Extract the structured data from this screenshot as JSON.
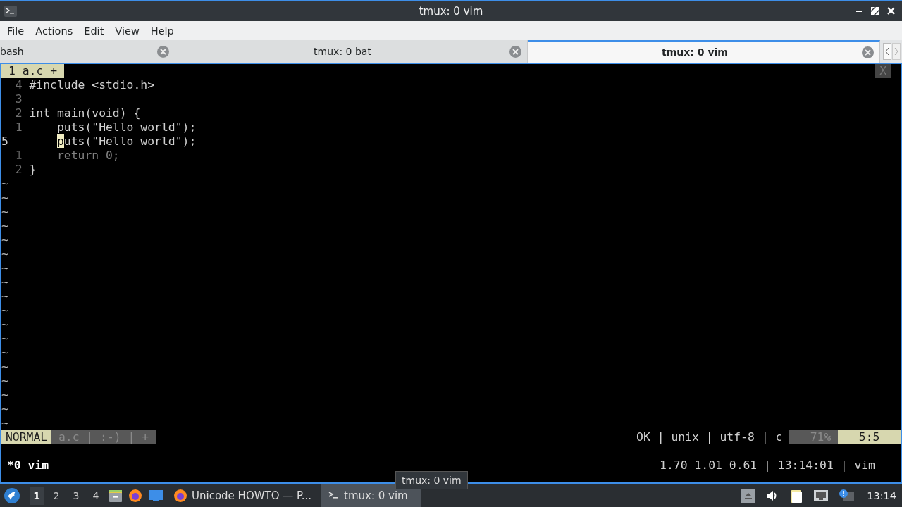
{
  "window": {
    "title": "tmux: 0 vim"
  },
  "menu": [
    "File",
    "Actions",
    "Edit",
    "View",
    "Help"
  ],
  "tabs": [
    {
      "label": "bash",
      "selected": false
    },
    {
      "label": "tmux: 0 bat",
      "selected": false
    },
    {
      "label": "tmux: 0 vim",
      "selected": true
    }
  ],
  "vim": {
    "tabline": {
      "label": "1 a.c +",
      "close": "X"
    },
    "lines": [
      {
        "number": "4",
        "text": "#include <stdio.h>",
        "current": false,
        "dim": false
      },
      {
        "number": "3",
        "current": false,
        "dim": false
      },
      {
        "number": "2",
        "text": "int main(void) {",
        "current": false,
        "dim": false
      },
      {
        "number": "1",
        "text": "    puts(\"Hello world\");",
        "current": false,
        "dim": false
      },
      {
        "number": "5",
        "current": true,
        "dim": false,
        "cursor": {
          "char": "p",
          "after": "uts(\"Hello world\");"
        }
      },
      {
        "number": "1",
        "text": "    return 0;",
        "current": false,
        "dim": true
      },
      {
        "number": "2",
        "text": "}",
        "current": false,
        "dim": false
      }
    ],
    "tildes": [
      "~",
      "~",
      "~",
      "~",
      "~",
      "~",
      "~",
      "~",
      "~",
      "~",
      "~",
      "~",
      "~",
      "~",
      "~",
      "~",
      "~",
      "~"
    ],
    "statusline": {
      "mode": "NORMAL",
      "file_info": "a.c | :-) | +",
      "right_info": "OK | unix | utf-8 | c",
      "percent": "71%",
      "position": "5:5"
    }
  },
  "tmux": {
    "left": "*0 vim",
    "right": "1.70 1.01 0.61 | 13:14:01 | vim"
  },
  "taskbar": {
    "desktops": [
      {
        "label": "1",
        "selected": true
      },
      {
        "label": "2",
        "selected": false
      },
      {
        "label": "3",
        "selected": false
      },
      {
        "label": "4",
        "selected": false
      }
    ],
    "tasks": [
      {
        "kind": "browser",
        "label": "Unicode HOWTO — P...",
        "selected": false
      },
      {
        "kind": "terminal",
        "label": "tmux: 0 vim",
        "selected": true
      }
    ],
    "tooltip": "tmux: 0 vim",
    "clock": "13:14"
  }
}
